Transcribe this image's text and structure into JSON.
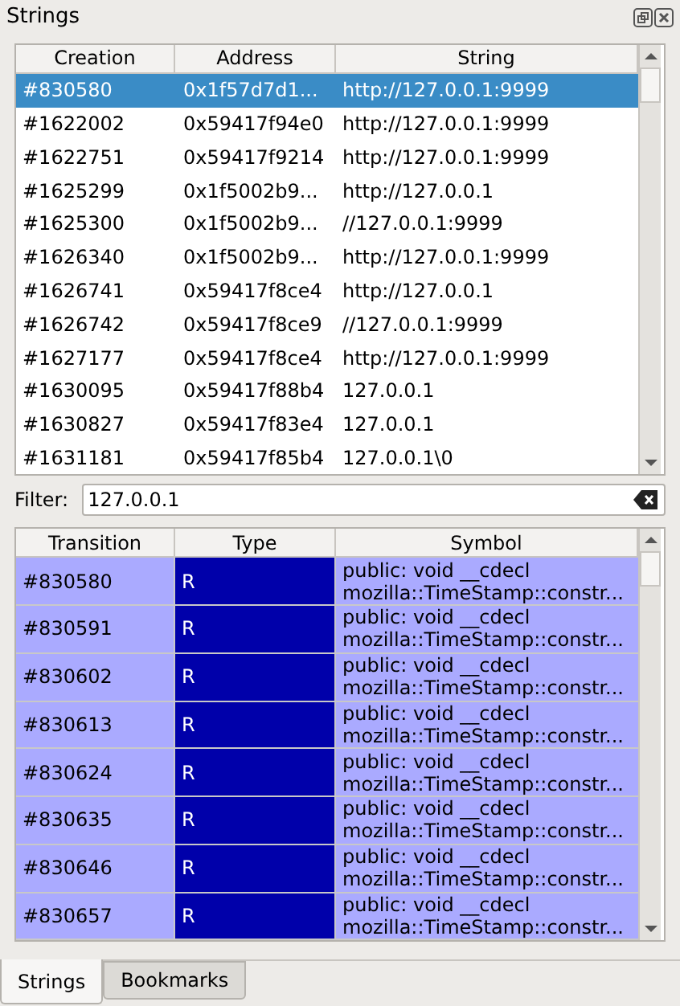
{
  "panel": {
    "title": "Strings"
  },
  "strings_table": {
    "columns": [
      "Creation",
      "Address",
      "String"
    ],
    "rows": [
      {
        "creation": "#830580",
        "address": "0x1f57d7d1...",
        "string": "http://127.0.0.1:9999",
        "selected": true
      },
      {
        "creation": "#1622002",
        "address": "0x59417f94e0",
        "string": "http://127.0.0.1:9999",
        "selected": false
      },
      {
        "creation": "#1622751",
        "address": "0x59417f9214",
        "string": "http://127.0.0.1:9999",
        "selected": false
      },
      {
        "creation": "#1625299",
        "address": "0x1f5002b9...",
        "string": "http://127.0.0.1",
        "selected": false
      },
      {
        "creation": "#1625300",
        "address": "0x1f5002b9...",
        "string": "//127.0.0.1:9999",
        "selected": false
      },
      {
        "creation": "#1626340",
        "address": "0x1f5002b9...",
        "string": "http://127.0.0.1:9999",
        "selected": false
      },
      {
        "creation": "#1626741",
        "address": "0x59417f8ce4",
        "string": "http://127.0.0.1",
        "selected": false
      },
      {
        "creation": "#1626742",
        "address": "0x59417f8ce9",
        "string": "//127.0.0.1:9999",
        "selected": false
      },
      {
        "creation": "#1627177",
        "address": "0x59417f8ce4",
        "string": "http://127.0.0.1:9999",
        "selected": false
      },
      {
        "creation": "#1630095",
        "address": "0x59417f88b4",
        "string": "127.0.0.1",
        "selected": false
      },
      {
        "creation": "#1630827",
        "address": "0x59417f83e4",
        "string": "127.0.0.1",
        "selected": false
      },
      {
        "creation": "#1631181",
        "address": "0x59417f85b4",
        "string": "127.0.0.1\\0",
        "selected": false
      }
    ]
  },
  "filter": {
    "label": "Filter:",
    "value": "127.0.0.1"
  },
  "transitions_table": {
    "columns": [
      "Transition",
      "Type",
      "Symbol"
    ],
    "rows": [
      {
        "transition": "#830580",
        "type": "R",
        "symbol": "public: void __cdecl mozilla::TimeStamp::constr..."
      },
      {
        "transition": "#830591",
        "type": "R",
        "symbol": "public: void __cdecl mozilla::TimeStamp::constr..."
      },
      {
        "transition": "#830602",
        "type": "R",
        "symbol": "public: void __cdecl mozilla::TimeStamp::constr..."
      },
      {
        "transition": "#830613",
        "type": "R",
        "symbol": "public: void __cdecl mozilla::TimeStamp::constr..."
      },
      {
        "transition": "#830624",
        "type": "R",
        "symbol": "public: void __cdecl mozilla::TimeStamp::constr..."
      },
      {
        "transition": "#830635",
        "type": "R",
        "symbol": "public: void __cdecl mozilla::TimeStamp::constr..."
      },
      {
        "transition": "#830646",
        "type": "R",
        "symbol": "public: void __cdecl mozilla::TimeStamp::constr..."
      },
      {
        "transition": "#830657",
        "type": "R",
        "symbol": "public: void __cdecl mozilla::TimeStamp::constr..."
      }
    ]
  },
  "tabs": [
    {
      "label": "Strings",
      "selected": true
    },
    {
      "label": "Bookmarks",
      "selected": false
    }
  ]
}
